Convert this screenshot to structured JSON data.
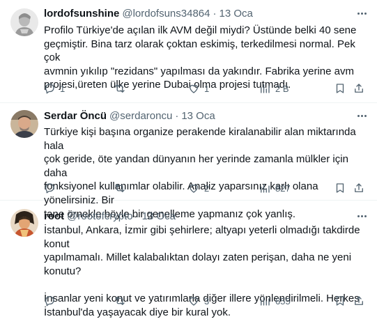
{
  "tweets": [
    {
      "name": "lordofsunshine",
      "handle": "@lordofsuns34864",
      "sep": "·",
      "time": "13 Oca",
      "text": "Profilo Türkiye'de açılan ilk AVM değil miydi? Üstünde belki 40 sene\ngeçmiştir. Bina tarz olarak çoktan eskimiş, terkedilmesi normal. Pek çok\navmnin yıkılıp \"rezidans\" yapılması da yakındır. Fabrika yerine avm\nprojesi,üreten ülke yerine Dubai olma projesi tutmadı.",
      "replies": "1",
      "retweets": "",
      "likes": "1",
      "views": "2 B"
    },
    {
      "name": "Serdar Öncü",
      "handle": "@serdaroncu",
      "sep": "·",
      "time": "13 Oca",
      "text": "Türkiye kişi başına organize perakende kiralanabilir alan miktarında hala\nçok geride, öte yandan dünyanın her yerinde zamanla mülkler için daha\nfonksiyonel kullanımlar olabilir. Analiz yaparsınız karlı olana yönelirsiniz. Bir\ntane örnekle böyle bir genelleme yapmanız çok yanlış.",
      "replies": "",
      "retweets": "",
      "likes": "2",
      "views": "827"
    },
    {
      "name": "root",
      "handle": "@rootofcrypto",
      "sep": "·",
      "time": "13 Oca",
      "text": "İstanbul, Ankara, İzmir gibi şehirlere; altyapı yeterli olmadığı takdirde konut\nyapılmamalı. Millet kalabalıktan dolayı zaten perişan, daha ne yeni konutu?\n\nİnsanlar yeni konut ve yatırımlarla diğer illere yönlendirilmeli. Herkes\nİstanbul'da yaşayacak diye bir kural yok.",
      "replies": "",
      "retweets": "",
      "likes": "3",
      "views": "655"
    }
  ],
  "icons": [
    "more-icon",
    "reply-icon",
    "retweet-icon",
    "like-icon",
    "views-icon",
    "bookmark-icon",
    "share-icon"
  ]
}
